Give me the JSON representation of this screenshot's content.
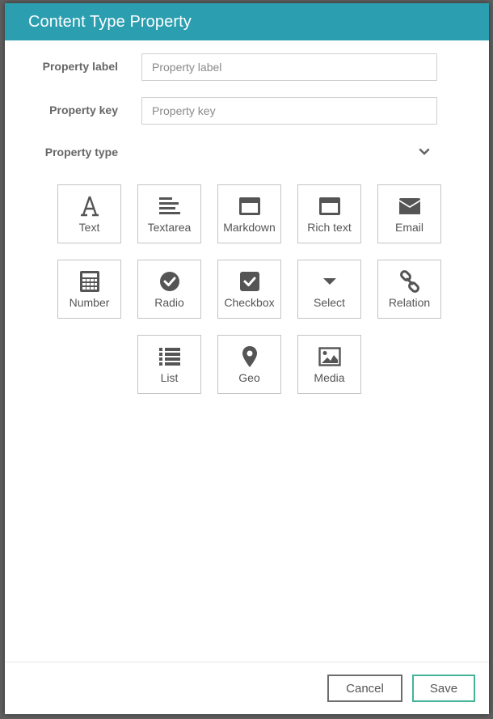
{
  "dialog": {
    "title": "Content Type Property"
  },
  "form": {
    "label_field": {
      "label": "Property label",
      "placeholder": "Property label",
      "value": ""
    },
    "key_field": {
      "label": "Property key",
      "placeholder": "Property key",
      "value": ""
    },
    "type_field": {
      "label": "Property type",
      "toggle_icon": "chevron-down-icon"
    }
  },
  "types": [
    {
      "label": "Text",
      "icon": "text-font-icon"
    },
    {
      "label": "Textarea",
      "icon": "align-left-icon"
    },
    {
      "label": "Markdown",
      "icon": "window-icon"
    },
    {
      "label": "Rich text",
      "icon": "window-icon"
    },
    {
      "label": "Email",
      "icon": "envelope-icon"
    },
    {
      "label": "Number",
      "icon": "calculator-icon"
    },
    {
      "label": "Radio",
      "icon": "check-circle-icon"
    },
    {
      "label": "Checkbox",
      "icon": "check-square-icon"
    },
    {
      "label": "Select",
      "icon": "caret-down-icon"
    },
    {
      "label": "Relation",
      "icon": "link-icon"
    },
    {
      "label": "List",
      "icon": "list-icon"
    },
    {
      "label": "Geo",
      "icon": "map-marker-icon"
    },
    {
      "label": "Media",
      "icon": "image-icon"
    }
  ],
  "footer": {
    "cancel_label": "Cancel",
    "save_label": "Save"
  },
  "colors": {
    "header": "#2b9fb0",
    "save_border": "#45b398",
    "cancel_border": "#6d6d6d",
    "icon": "#555555"
  }
}
